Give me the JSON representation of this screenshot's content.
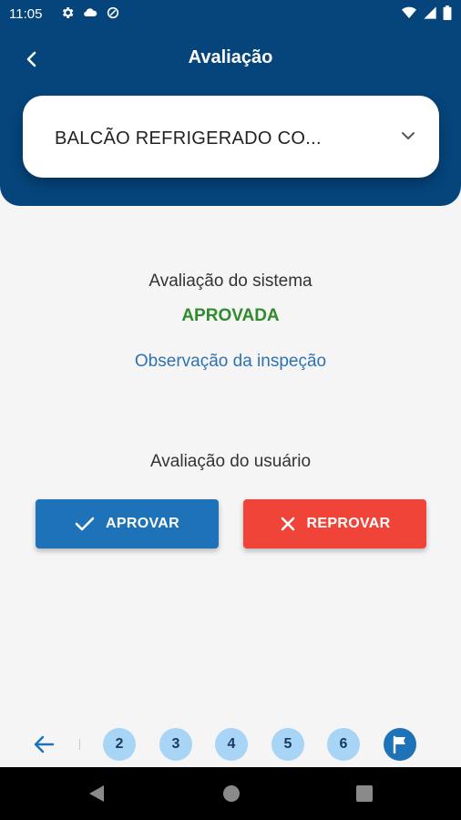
{
  "status_bar": {
    "time": "11:05",
    "left_icons": [
      "gear-icon",
      "cloud-icon",
      "data-saver-icon"
    ],
    "right_icons": [
      "wifi-icon",
      "signal-icon",
      "battery-icon"
    ]
  },
  "header": {
    "title": "Avaliação",
    "background_color": "#05457c"
  },
  "equipment_select": {
    "value": "BALCÃO REFRIGERADO CO..."
  },
  "system_evaluation": {
    "label": "Avaliação do sistema",
    "status": "APROVADA",
    "status_color": "#2e8b2e",
    "observation_link": "Observação da inspeção"
  },
  "user_evaluation": {
    "label": "Avaliação do usuário",
    "approve_label": "APROVAR",
    "reject_label": "REPROVAR",
    "approve_color": "#1e72b8",
    "reject_color": "#f04438"
  },
  "pager": {
    "pages": [
      "2",
      "3",
      "4",
      "5",
      "6"
    ],
    "final_icon": "flag-icon"
  }
}
